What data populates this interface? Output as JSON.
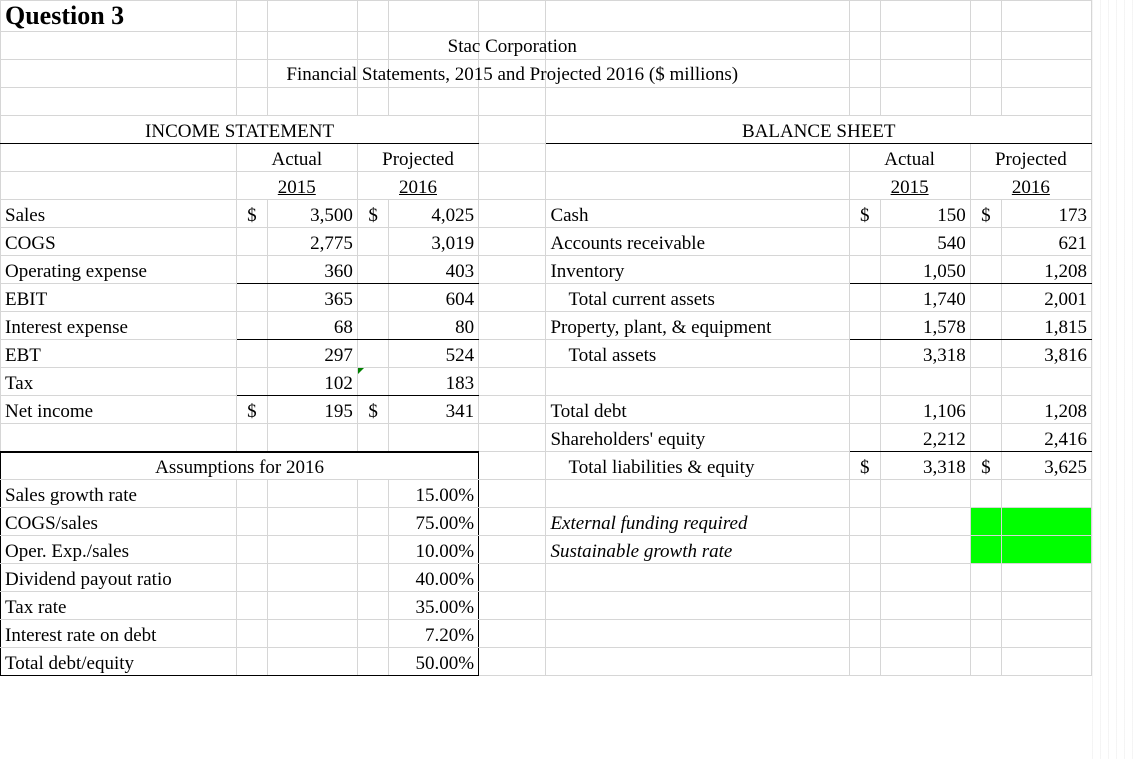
{
  "title": "Question 3",
  "company": "Stac Corporation",
  "subtitle": "Financial Statements, 2015 and Projected 2016 ($ millions)",
  "headers": {
    "income": "INCOME STATEMENT",
    "balance": "BALANCE SHEET",
    "actual": "Actual",
    "projected": "Projected",
    "y2015": "2015",
    "y2016": "2016"
  },
  "income": {
    "sales": {
      "label": "Sales",
      "a": "3,500",
      "p": "4,025"
    },
    "cogs": {
      "label": "COGS",
      "a": "2,775",
      "p": "3,019"
    },
    "opex": {
      "label": "Operating expense",
      "a": "360",
      "p": "403"
    },
    "ebit": {
      "label": "EBIT",
      "a": "365",
      "p": "604"
    },
    "intexp": {
      "label": "Interest expense",
      "a": "68",
      "p": "80"
    },
    "ebt": {
      "label": "EBT",
      "a": "297",
      "p": "524"
    },
    "tax": {
      "label": "Tax",
      "a": "102",
      "p": "183"
    },
    "ni": {
      "label": "Net income",
      "a": "195",
      "p": "341"
    }
  },
  "balance": {
    "cash": {
      "label": "Cash",
      "a": "150",
      "p": "173"
    },
    "ar": {
      "label": "Accounts receivable",
      "a": "540",
      "p": "621"
    },
    "inv": {
      "label": "Inventory",
      "a": "1,050",
      "p": "1,208"
    },
    "tca": {
      "label": "Total current assets",
      "a": "1,740",
      "p": "2,001"
    },
    "ppe": {
      "label": "Property, plant, & equipment",
      "a": "1,578",
      "p": "1,815"
    },
    "ta": {
      "label": "Total assets",
      "a": "3,318",
      "p": "3,816"
    },
    "td": {
      "label": "Total debt",
      "a": "1,106",
      "p": "1,208"
    },
    "se": {
      "label": "Shareholders' equity",
      "a": "2,212",
      "p": "2,416"
    },
    "tle": {
      "label": "Total liabilities & equity",
      "a": "3,318",
      "p": "3,625"
    }
  },
  "assumptions": {
    "title": "Assumptions for 2016",
    "rows": [
      {
        "label": "Sales growth rate",
        "val": "15.00%"
      },
      {
        "label": "COGS/sales",
        "val": "75.00%"
      },
      {
        "label": "Oper. Exp./sales",
        "val": "10.00%"
      },
      {
        "label": "Dividend payout ratio",
        "val": "40.00%"
      },
      {
        "label": "Tax rate",
        "val": "35.00%"
      },
      {
        "label": "Interest rate on debt",
        "val": "7.20%"
      },
      {
        "label": "Total debt/equity",
        "val": "50.00%"
      }
    ]
  },
  "extras": {
    "efr": "External funding required",
    "sgr": "Sustainable growth rate"
  },
  "currency": "$",
  "chart_data": {
    "type": "table",
    "note": "income statement and balance sheet values captured above in 'income' and 'balance' objects"
  }
}
